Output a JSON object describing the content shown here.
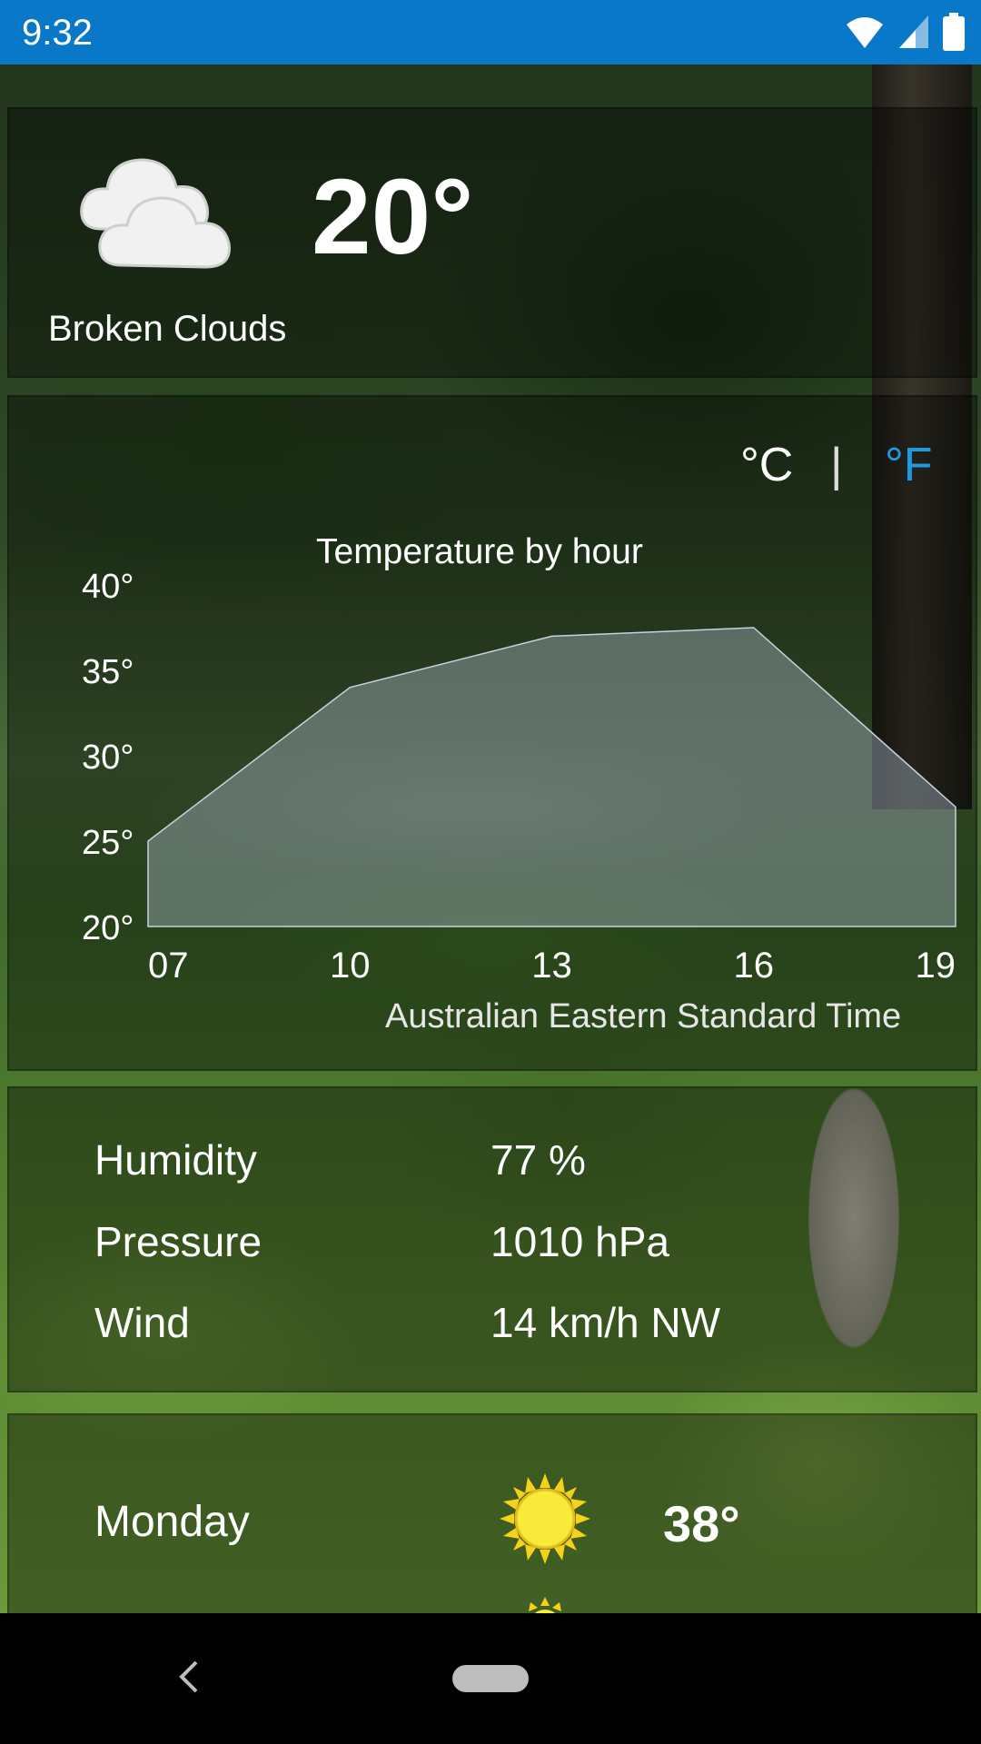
{
  "status_bar": {
    "time": "9:32"
  },
  "current": {
    "temperature": "20°",
    "condition": "Broken Clouds",
    "icon": "cloud-icon"
  },
  "units": {
    "celsius": "°C",
    "separator": "|",
    "fahrenheit": "°F",
    "active_color": "#1e9be0"
  },
  "chart_data": {
    "type": "area",
    "title": "Temperature by hour",
    "x": [
      7,
      10,
      13,
      16,
      19
    ],
    "x_tick_labels": [
      "07",
      "10",
      "13",
      "16",
      "19"
    ],
    "values": [
      25,
      34,
      37,
      37.5,
      27
    ],
    "y_tick_labels": [
      "40°",
      "35°",
      "30°",
      "25°",
      "20°"
    ],
    "ylim": [
      20,
      40
    ],
    "xlim": [
      7,
      19
    ],
    "fill_color": "#a9b7c8",
    "xlabel": "Australian Eastern Standard Time"
  },
  "details": [
    {
      "label": "Humidity",
      "value": "77 %"
    },
    {
      "label": "Pressure",
      "value": "1010 hPa"
    },
    {
      "label": "Wind",
      "value": "14 km/h NW"
    }
  ],
  "forecast": [
    {
      "day": "Monday",
      "temp": "38°",
      "icon": "sun-icon"
    }
  ]
}
